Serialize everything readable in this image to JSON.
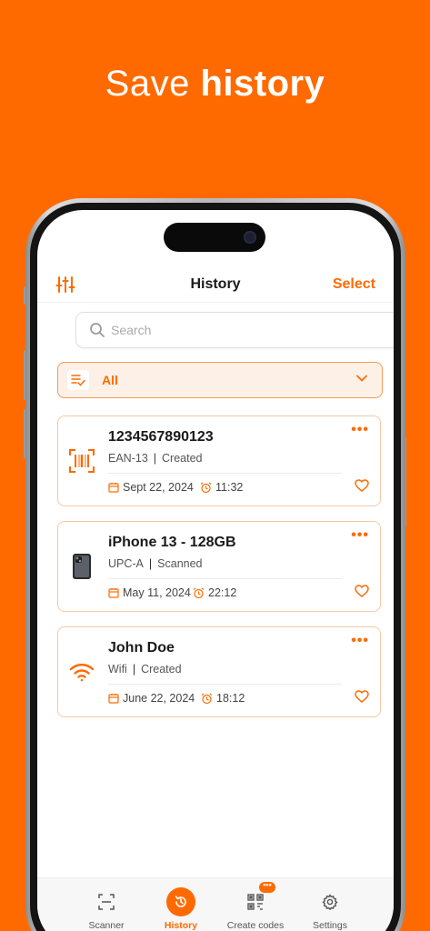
{
  "headline": {
    "regular": "Save ",
    "bold": "history"
  },
  "header": {
    "title": "History",
    "select_label": "Select"
  },
  "search": {
    "placeholder": "Search",
    "value": ""
  },
  "filter": {
    "selected": "All"
  },
  "cards": [
    {
      "name": "1234567890123",
      "type": "EAN-13",
      "action": "Created",
      "date": "Sept 22, 2024",
      "time": "11:32",
      "icon": "barcode-icon"
    },
    {
      "name": "iPhone 13 - 128GB",
      "type": "UPC-A",
      "action": "Scanned",
      "date": "May 11, 2024",
      "time": "22:12",
      "icon": "phone-product-icon"
    },
    {
      "name": "John Doe",
      "type": "Wifi",
      "action": "Created",
      "date": "June 22, 2024",
      "time": "18:12",
      "icon": "wifi-icon"
    }
  ],
  "tabs": [
    {
      "label": "Scanner",
      "icon": "scanner-icon"
    },
    {
      "label": "History",
      "icon": "history-icon",
      "active": true
    },
    {
      "label": "Create codes",
      "icon": "qr-create-icon",
      "badge": "•••"
    },
    {
      "label": "Settings",
      "icon": "gear-icon"
    }
  ],
  "colors": {
    "accent": "#FF6A00",
    "card_border": "#F6C9A6",
    "filter_bg": "#FDF0E7"
  }
}
